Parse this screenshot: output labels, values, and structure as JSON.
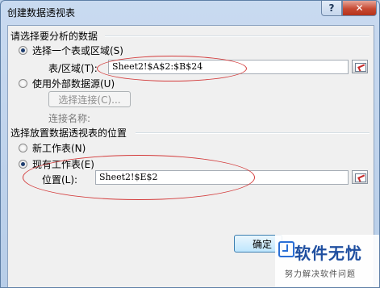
{
  "dialog": {
    "title": "创建数据透视表",
    "help": "?",
    "close": "✕"
  },
  "section_analyze": {
    "heading": "请选择要分析的数据",
    "option_range": "选择一个表或区域(S)",
    "range_label": "表/区域(T):",
    "range_value": "Sheet2!$A$2:$B$24",
    "option_external": "使用外部数据源(U)",
    "choose_connection": "选择连接(C)...",
    "connection_name_label": "连接名称:"
  },
  "section_place": {
    "heading": "选择放置数据透视表的位置",
    "option_new": "新工作表(N)",
    "option_existing": "现有工作表(E)",
    "location_label": "位置(L):",
    "location_value": "Sheet2!$E$2"
  },
  "footer": {
    "ok_label": "确定"
  },
  "watermark": {
    "title": "软件无忧",
    "subtitle": "努力解决软件问题"
  },
  "colors": {
    "annotation": "#d33a3a",
    "selected_radio": "#1e3d6e"
  }
}
